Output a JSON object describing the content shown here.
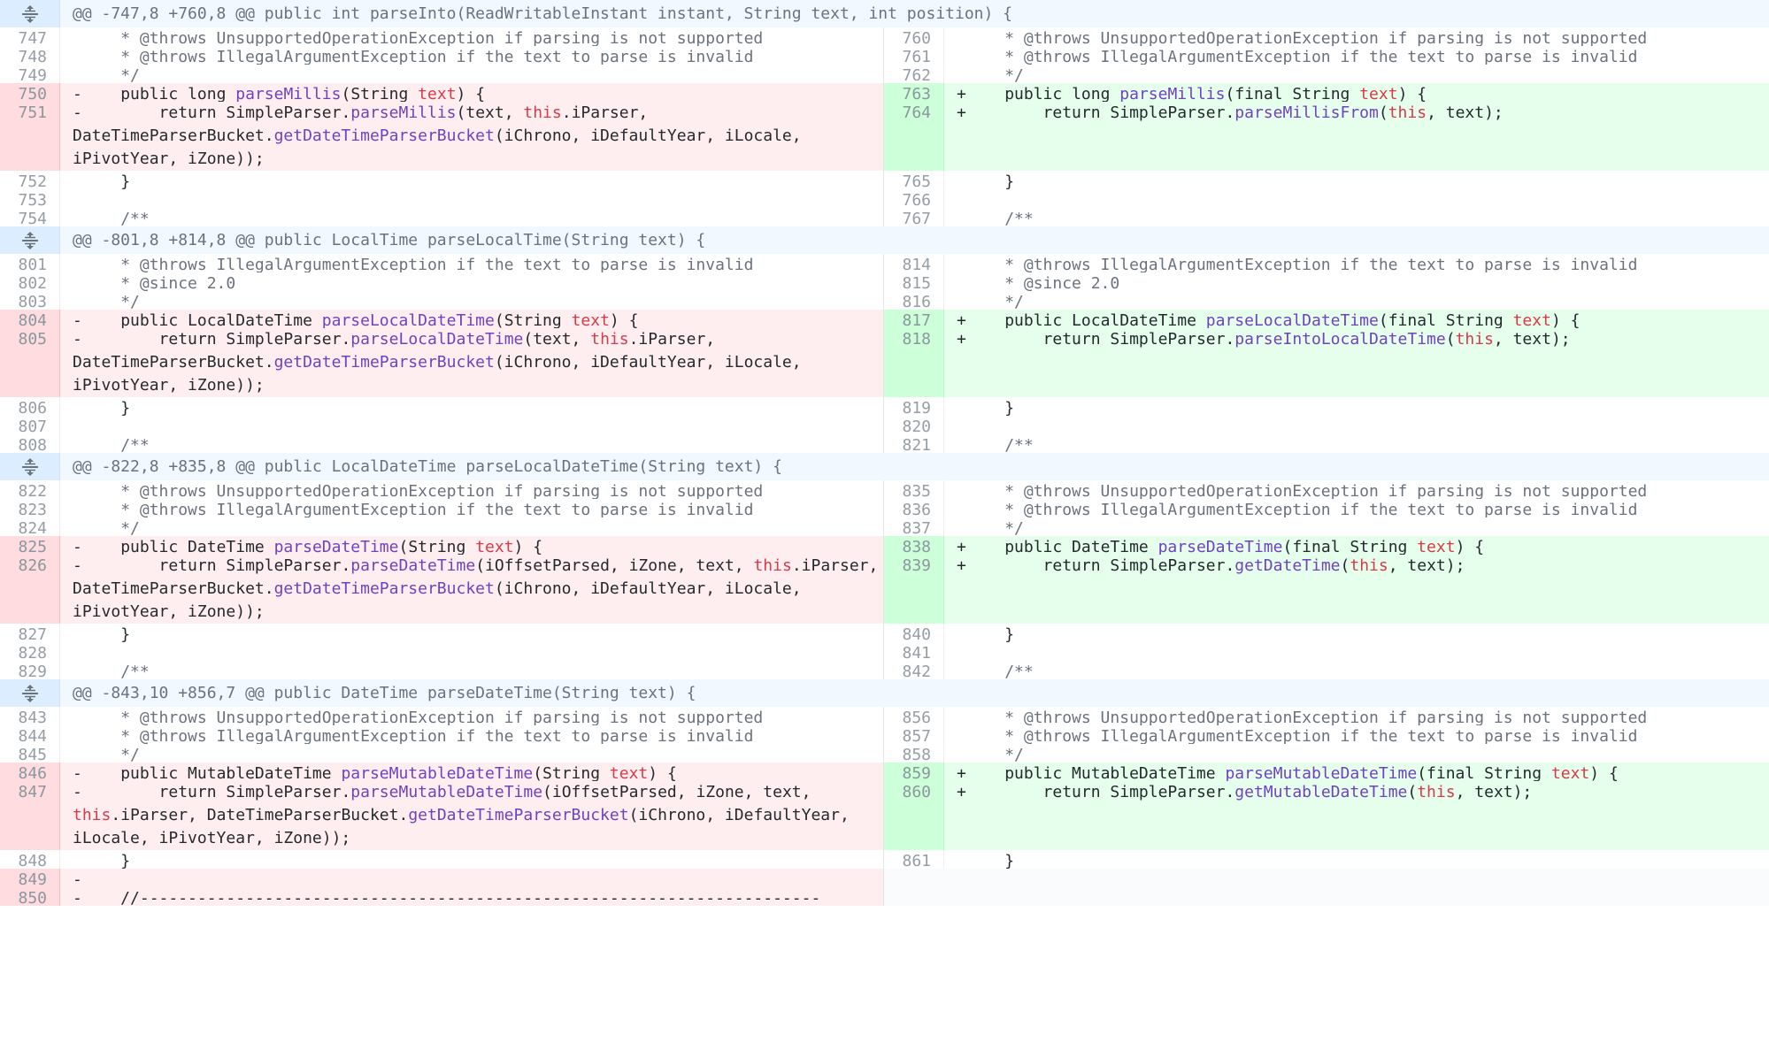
{
  "hunks": [
    {
      "header": "@@ -747,8 +760,8 @@ public int parseInto(ReadWritableInstant instant, String text, int position) {",
      "left": [
        {
          "n": "747",
          "t": "ctx",
          "c": "     * @throws UnsupportedOperationException if parsing is not supported"
        },
        {
          "n": "748",
          "t": "ctx",
          "c": "     * @throws IllegalArgumentException if the text to parse is invalid"
        },
        {
          "n": "749",
          "t": "ctx",
          "c": "     */"
        },
        {
          "n": "750",
          "t": "del",
          "c": "-    public long parseMillis(String text) {"
        },
        {
          "n": "751",
          "t": "del",
          "c": "-        return SimpleParser.parseMillis(text, this.iParser,\nDateTimeParserBucket.getDateTimeParserBucket(iChrono, iDefaultYear, iLocale,\niPivotYear, iZone));"
        },
        {
          "n": "752",
          "t": "ctx",
          "c": "     }"
        },
        {
          "n": "753",
          "t": "ctx",
          "c": ""
        },
        {
          "n": "754",
          "t": "ctx",
          "c": "     /**"
        }
      ],
      "right": [
        {
          "n": "760",
          "t": "ctx",
          "c": "     * @throws UnsupportedOperationException if parsing is not supported"
        },
        {
          "n": "761",
          "t": "ctx",
          "c": "     * @throws IllegalArgumentException if the text to parse is invalid"
        },
        {
          "n": "762",
          "t": "ctx",
          "c": "     */"
        },
        {
          "n": "763",
          "t": "add",
          "c": "+    public long parseMillis(final String text) {"
        },
        {
          "n": "764",
          "t": "add",
          "c": "+        return SimpleParser.parseMillisFrom(this, text);\n\n"
        },
        {
          "n": "765",
          "t": "ctx",
          "c": "     }"
        },
        {
          "n": "766",
          "t": "ctx",
          "c": ""
        },
        {
          "n": "767",
          "t": "ctx",
          "c": "     /**"
        }
      ]
    },
    {
      "header": "@@ -801,8 +814,8 @@ public LocalTime parseLocalTime(String text) {",
      "left": [
        {
          "n": "801",
          "t": "ctx",
          "c": "     * @throws IllegalArgumentException if the text to parse is invalid"
        },
        {
          "n": "802",
          "t": "ctx",
          "c": "     * @since 2.0"
        },
        {
          "n": "803",
          "t": "ctx",
          "c": "     */"
        },
        {
          "n": "804",
          "t": "del",
          "c": "-    public LocalDateTime parseLocalDateTime(String text) {"
        },
        {
          "n": "805",
          "t": "del",
          "c": "-        return SimpleParser.parseLocalDateTime(text, this.iParser,\nDateTimeParserBucket.getDateTimeParserBucket(iChrono, iDefaultYear, iLocale,\niPivotYear, iZone));"
        },
        {
          "n": "806",
          "t": "ctx",
          "c": "     }"
        },
        {
          "n": "807",
          "t": "ctx",
          "c": ""
        },
        {
          "n": "808",
          "t": "ctx",
          "c": "     /**"
        }
      ],
      "right": [
        {
          "n": "814",
          "t": "ctx",
          "c": "     * @throws IllegalArgumentException if the text to parse is invalid"
        },
        {
          "n": "815",
          "t": "ctx",
          "c": "     * @since 2.0"
        },
        {
          "n": "816",
          "t": "ctx",
          "c": "     */"
        },
        {
          "n": "817",
          "t": "add",
          "c": "+    public LocalDateTime parseLocalDateTime(final String text) {"
        },
        {
          "n": "818",
          "t": "add",
          "c": "+        return SimpleParser.parseIntoLocalDateTime(this, text);\n\n"
        },
        {
          "n": "819",
          "t": "ctx",
          "c": "     }"
        },
        {
          "n": "820",
          "t": "ctx",
          "c": ""
        },
        {
          "n": "821",
          "t": "ctx",
          "c": "     /**"
        }
      ]
    },
    {
      "header": "@@ -822,8 +835,8 @@ public LocalDateTime parseLocalDateTime(String text) {",
      "left": [
        {
          "n": "822",
          "t": "ctx",
          "c": "     * @throws UnsupportedOperationException if parsing is not supported"
        },
        {
          "n": "823",
          "t": "ctx",
          "c": "     * @throws IllegalArgumentException if the text to parse is invalid"
        },
        {
          "n": "824",
          "t": "ctx",
          "c": "     */"
        },
        {
          "n": "825",
          "t": "del",
          "c": "-    public DateTime parseDateTime(String text) {"
        },
        {
          "n": "826",
          "t": "del",
          "c": "-        return SimpleParser.parseDateTime(iOffsetParsed, iZone, text, this.iParser,\nDateTimeParserBucket.getDateTimeParserBucket(iChrono, iDefaultYear, iLocale,\niPivotYear, iZone));"
        },
        {
          "n": "827",
          "t": "ctx",
          "c": "     }"
        },
        {
          "n": "828",
          "t": "ctx",
          "c": ""
        },
        {
          "n": "829",
          "t": "ctx",
          "c": "     /**"
        }
      ],
      "right": [
        {
          "n": "835",
          "t": "ctx",
          "c": "     * @throws UnsupportedOperationException if parsing is not supported"
        },
        {
          "n": "836",
          "t": "ctx",
          "c": "     * @throws IllegalArgumentException if the text to parse is invalid"
        },
        {
          "n": "837",
          "t": "ctx",
          "c": "     */"
        },
        {
          "n": "838",
          "t": "add",
          "c": "+    public DateTime parseDateTime(final String text) {"
        },
        {
          "n": "839",
          "t": "add",
          "c": "+        return SimpleParser.getDateTime(this, text);\n\n"
        },
        {
          "n": "840",
          "t": "ctx",
          "c": "     }"
        },
        {
          "n": "841",
          "t": "ctx",
          "c": ""
        },
        {
          "n": "842",
          "t": "ctx",
          "c": "     /**"
        }
      ]
    },
    {
      "header": "@@ -843,10 +856,7 @@ public DateTime parseDateTime(String text) {",
      "left": [
        {
          "n": "843",
          "t": "ctx",
          "c": "     * @throws UnsupportedOperationException if parsing is not supported"
        },
        {
          "n": "844",
          "t": "ctx",
          "c": "     * @throws IllegalArgumentException if the text to parse is invalid"
        },
        {
          "n": "845",
          "t": "ctx",
          "c": "     */"
        },
        {
          "n": "846",
          "t": "del",
          "c": "-    public MutableDateTime parseMutableDateTime(String text) {"
        },
        {
          "n": "847",
          "t": "del",
          "c": "-        return SimpleParser.parseMutableDateTime(iOffsetParsed, iZone, text,\nthis.iParser, DateTimeParserBucket.getDateTimeParserBucket(iChrono, iDefaultYear,\niLocale, iPivotYear, iZone));"
        },
        {
          "n": "848",
          "t": "ctx",
          "c": "     }"
        },
        {
          "n": "849",
          "t": "del",
          "c": "-"
        },
        {
          "n": "850",
          "t": "del",
          "c": "-    //-----------------------------------------------------------------------"
        }
      ],
      "right": [
        {
          "n": "856",
          "t": "ctx",
          "c": "     * @throws UnsupportedOperationException if parsing is not supported"
        },
        {
          "n": "857",
          "t": "ctx",
          "c": "     * @throws IllegalArgumentException if the text to parse is invalid"
        },
        {
          "n": "858",
          "t": "ctx",
          "c": "     */"
        },
        {
          "n": "859",
          "t": "add",
          "c": "+    public MutableDateTime parseMutableDateTime(final String text) {"
        },
        {
          "n": "860",
          "t": "add",
          "c": "+        return SimpleParser.getMutableDateTime(this, text);\n\n"
        },
        {
          "n": "861",
          "t": "ctx",
          "c": "     }"
        },
        {
          "n": "",
          "t": "empty",
          "c": ""
        },
        {
          "n": "",
          "t": "empty",
          "c": ""
        }
      ]
    }
  ],
  "icons": {
    "expand": "unfold-icon"
  },
  "colors": {
    "deletion_bg": "#ffeef0",
    "addition_bg": "#e6ffed",
    "hunk_bg": "#f1f8ff",
    "keyword": "#d73a49",
    "function": "#6f42c1"
  }
}
